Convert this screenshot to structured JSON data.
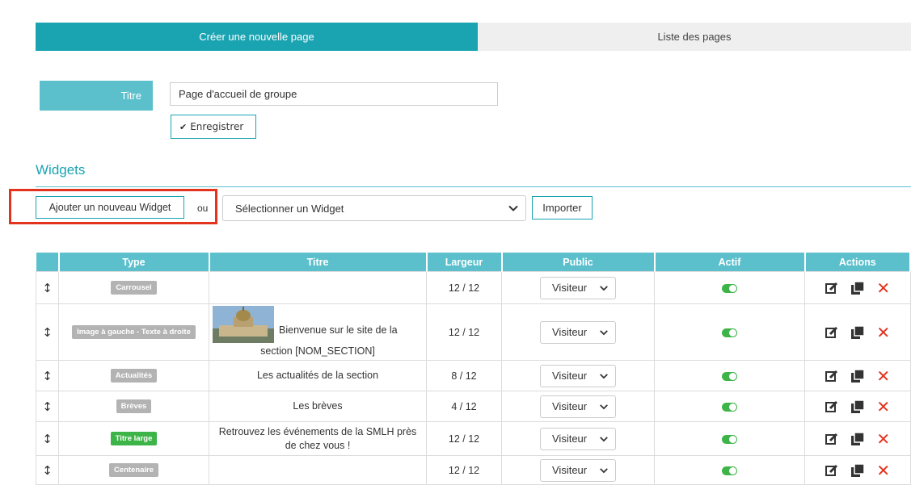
{
  "tabs": [
    {
      "label": "Créer une nouvelle page",
      "active": true
    },
    {
      "label": "Liste des pages",
      "active": false
    }
  ],
  "form": {
    "title_label": "Titre",
    "title_value": "Page d'accueil de groupe",
    "save_label": "Enregistrer"
  },
  "widgets": {
    "heading": "Widgets",
    "add_label": "Ajouter un nouveau Widget",
    "or_label": "ou",
    "select_value": "Sélectionner un Widget",
    "import_label": "Importer"
  },
  "table": {
    "headers": [
      "Type",
      "Titre",
      "Largeur",
      "Public",
      "Actif",
      "Actions"
    ],
    "rows": [
      {
        "type": "Carrousel",
        "title": "",
        "width": "12 / 12",
        "public": "Visiteur",
        "active": true
      },
      {
        "type": "Image à gauche - Texte à droite",
        "title_line1": "Bienvenue sur le site de la",
        "title_line2": "section [NOM_SECTION]",
        "width": "12 / 12",
        "public": "Visiteur",
        "active": true
      },
      {
        "type": "Actualités",
        "title": "Les actualités de la section",
        "width": "8 / 12",
        "public": "Visiteur",
        "active": true
      },
      {
        "type": "Brèves",
        "title": "Les brèves",
        "width": "4 / 12",
        "public": "Visiteur",
        "active": true
      },
      {
        "type": "Titre large",
        "title": "Retrouvez les événements de la SMLH près de chez vous !",
        "width": "12 / 12",
        "public": "Visiteur",
        "active": true
      },
      {
        "type": "Centenaire",
        "title": "",
        "width": "12 / 12",
        "public": "Visiteur",
        "active": true
      }
    ]
  },
  "colors": {
    "accent": "#1aa3b1",
    "header": "#5bc0cc",
    "highlight": "#e3331c",
    "badge_grey": "#b3b3b3",
    "badge_green": "#3cb447",
    "delete": "#e3331c"
  },
  "icons": {
    "drag": "drag-handle-icon",
    "edit": "edit-icon",
    "duplicate": "duplicate-icon",
    "delete": "delete-icon",
    "toggle": "toggle-on-icon"
  }
}
